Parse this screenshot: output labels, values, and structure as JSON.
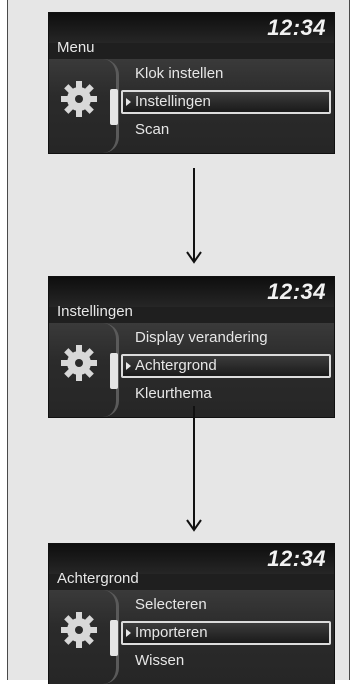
{
  "screens": [
    {
      "clock": "12:34",
      "title": "Menu",
      "items": [
        "Klok instellen",
        "Instellingen",
        "Scan"
      ],
      "selected_index": 1,
      "icon": "gear-icon"
    },
    {
      "clock": "12:34",
      "title": "Instellingen",
      "items": [
        "Display verandering",
        "Achtergrond",
        "Kleurthema"
      ],
      "selected_index": 1,
      "icon": "gear-icon"
    },
    {
      "clock": "12:34",
      "title": "Achtergrond",
      "items": [
        "Selecteren",
        "Importeren",
        "Wissen"
      ],
      "selected_index": 1,
      "icon": "gear-icon"
    }
  ],
  "arrows": [
    "arrow-down-icon",
    "arrow-down-icon"
  ],
  "colors": {
    "page_bg": "#e6e6e6",
    "screen_bg": "#1f1f1f",
    "text": "#e6e6e6",
    "selection_border": "#dcdcdc"
  }
}
